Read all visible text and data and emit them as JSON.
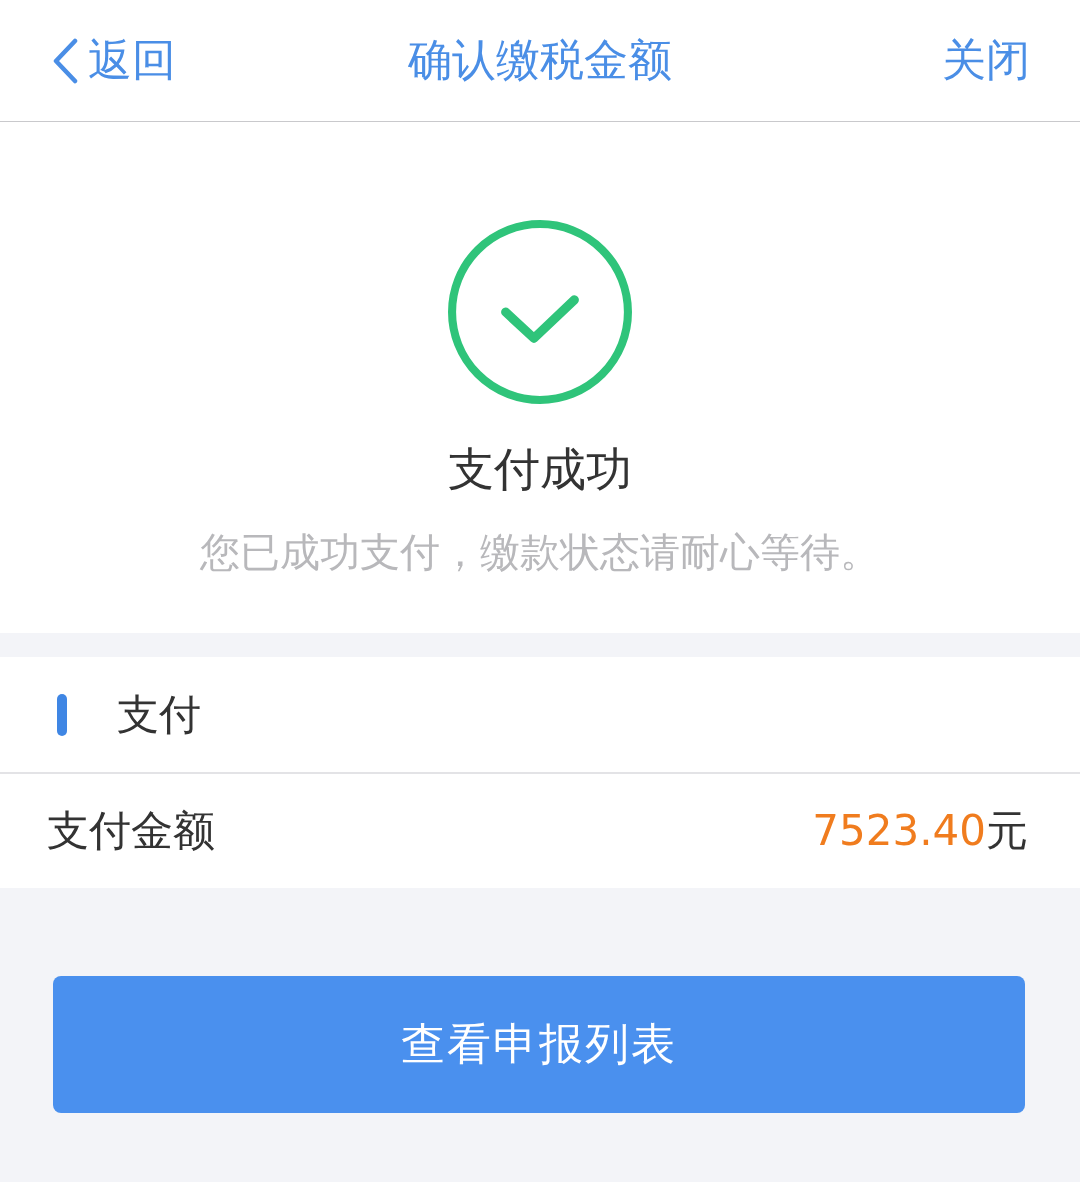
{
  "nav_bar": {
    "back_label": "返回",
    "title": "确认缴税金额",
    "close_label": "关闭"
  },
  "result": {
    "kind": "success",
    "title": "支付成功",
    "message": "您已成功支付，缴款状态请耐心等待。"
  },
  "payment_section": {
    "heading": "支付",
    "rows": [
      {
        "label": "支付金额",
        "amount": "7523.40",
        "unit": "元"
      }
    ]
  },
  "action_button": {
    "label": "查看申报列表"
  }
}
